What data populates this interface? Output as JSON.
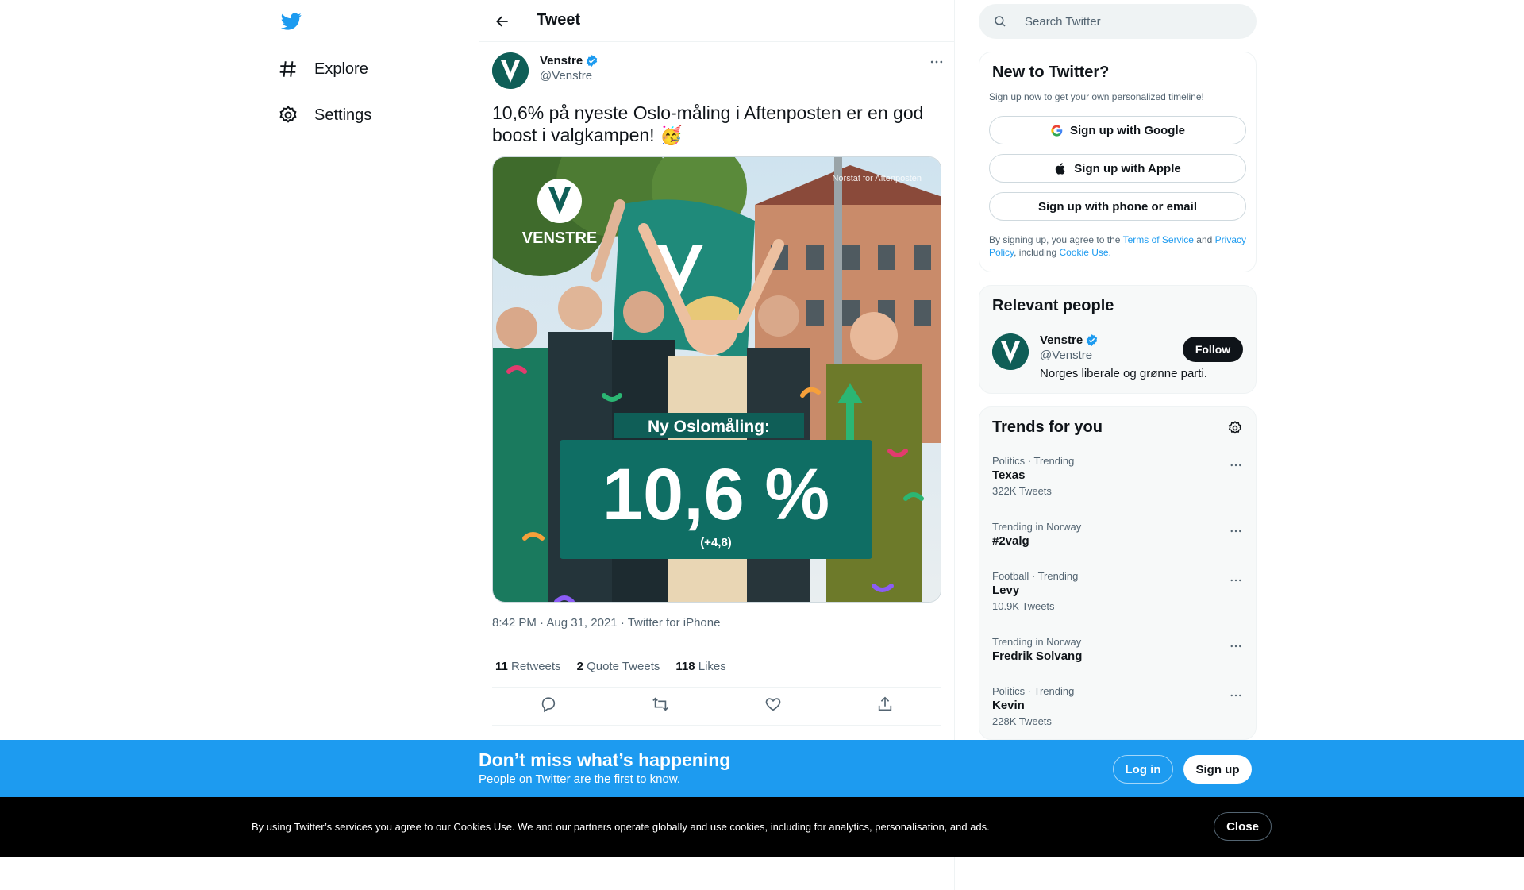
{
  "nav": {
    "items": [
      {
        "label": "Explore",
        "icon": "hashtag-icon"
      },
      {
        "label": "Settings",
        "icon": "gear-icon"
      }
    ]
  },
  "header": {
    "title": "Tweet"
  },
  "tweet": {
    "author_name": "Venstre",
    "author_handle": "@Venstre",
    "text": "10,6% på nyeste Oslo-måling i Aftenposten er en god boost i valgkampen! 🥳",
    "media": {
      "brand": "VENSTRE",
      "credit": "Norstat for Aftenposten",
      "headline": "Ny Oslomåling:",
      "big_value": "10,6 %",
      "delta": "(+4,8)"
    },
    "time": "8:42 PM",
    "date": "Aug 31, 2021",
    "source": "Twitter for iPhone",
    "retweets": "11",
    "retweets_label": "Retweets",
    "quotes": "2",
    "quotes_label": "Quote Tweets",
    "likes": "118",
    "likes_label": "Likes"
  },
  "search": {
    "placeholder": "Search Twitter"
  },
  "signup": {
    "title": "New to Twitter?",
    "subtitle": "Sign up now to get your own personalized timeline!",
    "google": "Sign up with Google",
    "apple": "Sign up with Apple",
    "phone": "Sign up with phone or email",
    "legal_prefix": "By signing up, you agree to the",
    "tos": "Terms of Service",
    "and": "and",
    "privacy": "Privacy Policy",
    "including": ", including",
    "cookie": "Cookie Use."
  },
  "relevant": {
    "title": "Relevant people",
    "name": "Venstre",
    "handle": "@Venstre",
    "bio": "Norges liberale og grønne parti.",
    "follow": "Follow"
  },
  "trends": {
    "title": "Trends for you",
    "items": [
      {
        "context": "Politics · Trending",
        "name": "Texas",
        "count": "322K Tweets"
      },
      {
        "context": "Trending in Norway",
        "name": "#2valg",
        "count": ""
      },
      {
        "context": "Football · Trending",
        "name": "Levy",
        "count": "10.9K Tweets"
      },
      {
        "context": "Trending in Norway",
        "name": "Fredrik Solvang",
        "count": ""
      },
      {
        "context": "Politics · Trending",
        "name": "Kevin",
        "count": "228K Tweets"
      }
    ]
  },
  "banner": {
    "title": "Don’t miss what’s happening",
    "subtitle": "People on Twitter are the first to know.",
    "login": "Log in",
    "signup": "Sign up"
  },
  "cookie_bar": {
    "text": "By using Twitter’s services you agree to our Cookies Use. We and our partners operate globally and use cookies, including for analytics, personalisation, and ads.",
    "close": "Close"
  },
  "colors": {
    "accent": "#1d9bf0",
    "brand_green": "#0f5e57",
    "text": "#0f1419",
    "muted": "#536471"
  }
}
